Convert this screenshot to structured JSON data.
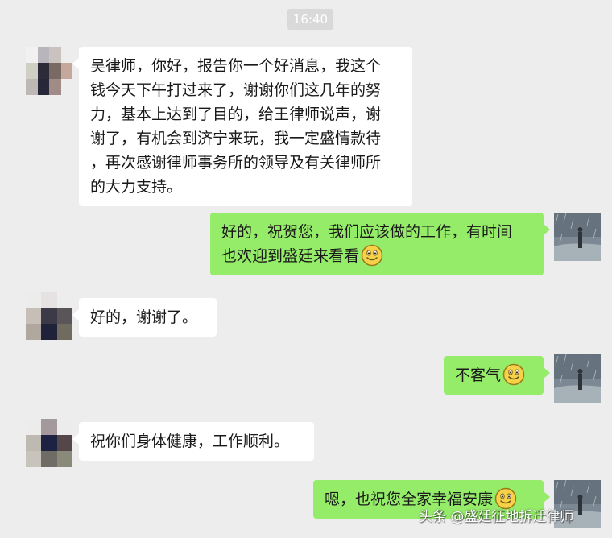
{
  "timestamp": "16:40",
  "contact_avatar_colors": [
    [
      "#e8e4e6",
      "#b9b5bc",
      "#c9c2bf",
      "#ffffff"
    ],
    [
      "#cfcfc3",
      "#2c2b3a",
      "#7a6a64",
      "#ffffff"
    ],
    [
      "#bdb8b3",
      "#27273a",
      "#a08b86",
      "#ffffff"
    ]
  ],
  "messages": [
    {
      "side": "left",
      "lines": [
        "吴律师，你好，报告你一个好消息，我这个",
        "钱今天下午打过来了，谢谢你们这几年的努",
        "力，基本上达到了目的，给王律师说声，谢",
        "谢了，有机会到济宁来玩，我一定盛情款待",
        "，再次感谢律师事务所的领导及有关律师所",
        "的大力支持。"
      ]
    },
    {
      "side": "right",
      "lines": [
        "好的，祝贺您，我们应该做的工作，有时间",
        "也欢迎到盛廷来看看"
      ],
      "emoji": "smiley"
    },
    {
      "side": "left",
      "lines": [
        "好的，谢谢了。"
      ]
    },
    {
      "side": "right",
      "lines": [
        "不客气"
      ],
      "emoji": "smiley"
    },
    {
      "side": "left",
      "lines": [
        "祝你们身体健康，工作顺利。"
      ]
    },
    {
      "side": "right",
      "lines": [
        "嗯，也祝您全家幸福安康"
      ],
      "emoji": "smiley"
    }
  ],
  "watermark": "头条 @盛廷征地拆迁律师",
  "colors": {
    "background": "#ededed",
    "bubble_right": "#95ec69",
    "bubble_left": "#ffffff"
  }
}
